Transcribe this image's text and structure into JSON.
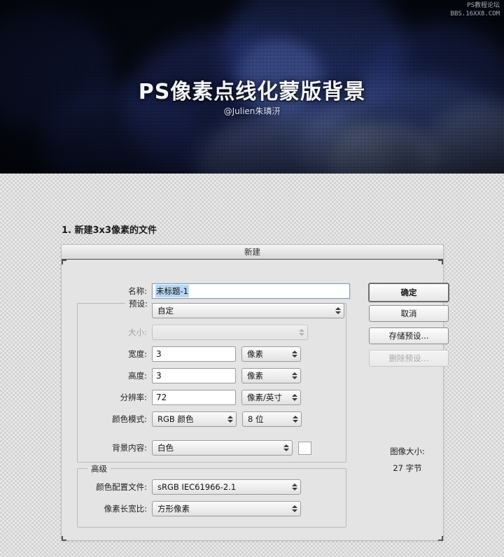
{
  "hero": {
    "title": "PS像素点线化蒙版背景",
    "subtitle": "@Julien朱璘汧",
    "watermark_line1": "PS教程论坛",
    "watermark_line2": "BBS.16XX8.COM"
  },
  "section": {
    "heading": "1. 新建3x3像素的文件"
  },
  "dialog": {
    "title": "新建",
    "name_label": "名称:",
    "name_value": "未标题-1",
    "preset_group_label": "预设:",
    "preset_value": "自定",
    "size_label": "大小:",
    "size_value": "",
    "width_label": "宽度:",
    "width_value": "3",
    "width_unit": "像素",
    "height_label": "高度:",
    "height_value": "3",
    "height_unit": "像素",
    "resolution_label": "分辨率:",
    "resolution_value": "72",
    "resolution_unit": "像素/英寸",
    "color_mode_label": "颜色模式:",
    "color_mode_value": "RGB 颜色",
    "bit_depth_value": "8 位",
    "background_label": "背景内容:",
    "background_value": "白色",
    "advanced_group_label": "高级",
    "color_profile_label": "颜色配置文件:",
    "color_profile_value": "sRGB IEC61966-2.1",
    "pixel_aspect_label": "像素长宽比:",
    "pixel_aspect_value": "方形像素",
    "ok_button": "确定",
    "cancel_button": "取消",
    "save_preset_button": "存储预设...",
    "delete_preset_button": "删除预设...",
    "image_size_label": "图像大小:",
    "image_size_value": "27 字节"
  },
  "colors": {
    "selection_highlight": "#b7d7f2",
    "dialog_bg": "#e4e4e4",
    "hero_blue": "#4a5fd0"
  }
}
